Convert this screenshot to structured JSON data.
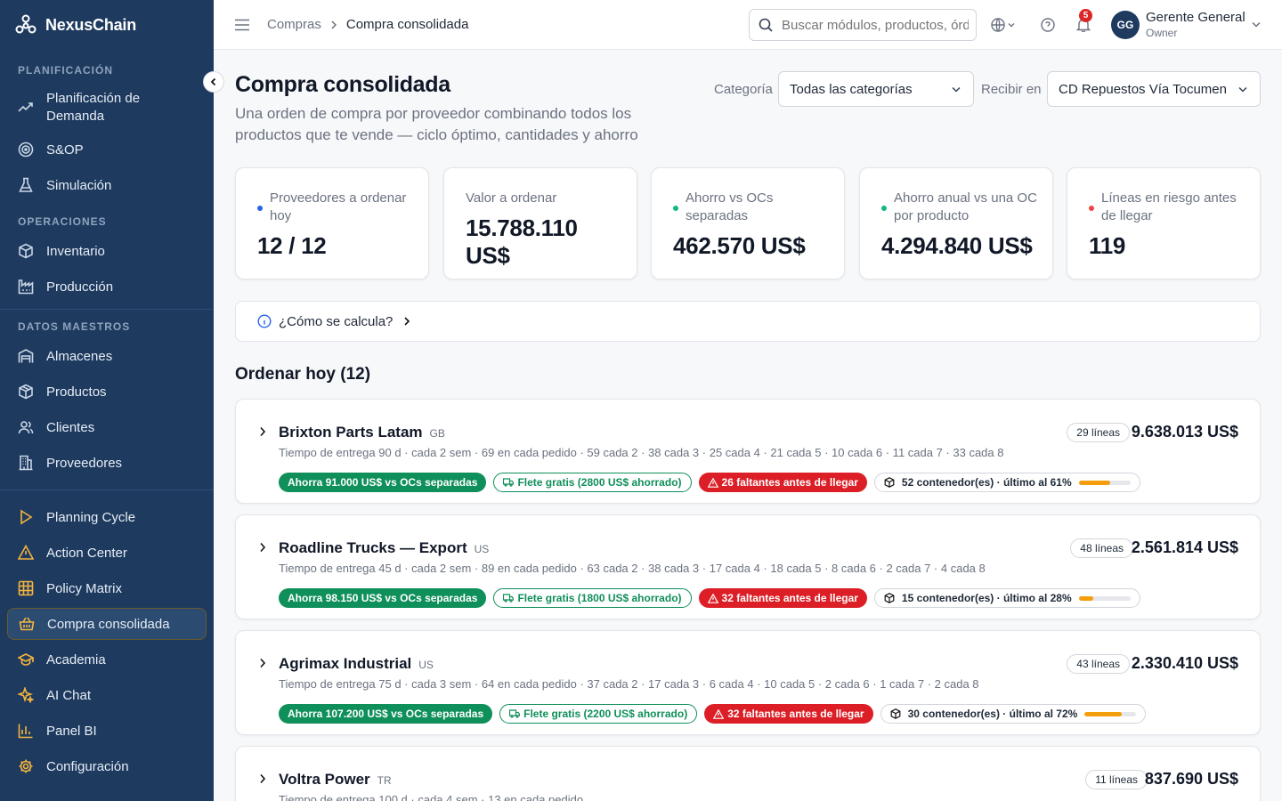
{
  "brand": {
    "name": "NexusChain"
  },
  "sidebar": {
    "sections": [
      {
        "title": "PLANIFICACIÓN",
        "items": [
          {
            "label": "Planificación de",
            "label2": "Demanda",
            "icon": "trend-icon"
          },
          {
            "label": "S&OP",
            "icon": "target-icon"
          },
          {
            "label": "Simulación",
            "icon": "flask-icon"
          }
        ]
      },
      {
        "title": "OPERACIONES",
        "items": [
          {
            "label": "Inventario",
            "icon": "box-icon"
          },
          {
            "label": "Producción",
            "icon": "factory-icon"
          }
        ]
      },
      {
        "title": "DATOS MAESTROS",
        "items": [
          {
            "label": "Almacenes",
            "icon": "warehouse-icon"
          },
          {
            "label": "Productos",
            "icon": "package-icon"
          },
          {
            "label": "Clientes",
            "icon": "users-icon"
          },
          {
            "label": "Proveedores",
            "icon": "building-icon"
          }
        ]
      }
    ],
    "bottom_items": [
      {
        "label": "Planning Cycle",
        "icon": "play-icon"
      },
      {
        "label": "Action Center",
        "icon": "warning-icon"
      },
      {
        "label": "Policy Matrix",
        "icon": "grid-icon"
      },
      {
        "label": "Compra consolidada",
        "icon": "basket-icon",
        "active": true
      },
      {
        "label": "Academia",
        "icon": "graduation-icon"
      },
      {
        "label": "AI Chat",
        "icon": "sparkle-icon"
      },
      {
        "label": "Panel BI",
        "icon": "bar-chart-icon"
      },
      {
        "label": "Configuración",
        "icon": "gear-icon"
      }
    ]
  },
  "topbar": {
    "breadcrumb": {
      "parent": "Compras",
      "separator": ">",
      "current": "Compra consolidada"
    },
    "search": {
      "placeholder": "Buscar módulos, productos, órdenes..."
    },
    "notifications": {
      "count": "5"
    },
    "user": {
      "initials": "GG",
      "name": "Gerente General",
      "role": "Owner"
    }
  },
  "header": {
    "title": "Compra consolidada",
    "subtitle": "Una orden de compra por proveedor combinando todos los productos que te vende — ciclo óptimo, cantidades y ahorro",
    "filters": {
      "category_label": "Categoría",
      "category_value": "Todas las categorías",
      "receive_label": "Recibir en",
      "receive_value": "CD Repuestos Vía Tocumen"
    }
  },
  "kpis": [
    {
      "label": "Proveedores a ordenar hoy",
      "value": "12 / 12",
      "dot": "#2563eb"
    },
    {
      "label": "Valor a ordenar",
      "value": "15.788.110 US$",
      "dot": ""
    },
    {
      "label": "Ahorro vs OCs separadas",
      "value": "462.570 US$",
      "dot": "#10b981"
    },
    {
      "label": "Ahorro anual vs una OC por producto",
      "value": "4.294.840 US$",
      "dot": "#10b981"
    },
    {
      "label": "Líneas en riesgo antes de llegar",
      "value": "119",
      "dot": "#ef4444"
    }
  ],
  "howto": {
    "label": "¿Cómo se calcula?"
  },
  "order_today": {
    "title": "Ordenar hoy (12)"
  },
  "suppliers": [
    {
      "name": "Brixton Parts Latam",
      "country": "GB",
      "meta": "Tiempo de entrega 90 d · cada 2 sem · 69 en cada pedido · 59 cada 2 · 38 cada 3 · 25 cada 4 · 21 cada 5 · 10 cada 6 · 11 cada 7 · 33 cada 8",
      "lines": "29 líneas",
      "total": "9.638.013 US$",
      "saving": "Ahorra 91.000 US$ vs OCs separadas",
      "freight": "Flete gratis (2800 US$ ahorrado)",
      "shortage": "26 faltantes antes de llegar",
      "containers": "52 contenedor(es) · último al 61%",
      "fill": 0.61
    },
    {
      "name": "Roadline Trucks — Export",
      "country": "US",
      "meta": "Tiempo de entrega 45 d · cada 2 sem · 89 en cada pedido · 63 cada 2 · 38 cada 3 · 17 cada 4 · 18 cada 5 · 8 cada 6 · 2 cada 7 · 4 cada 8",
      "lines": "48 líneas",
      "total": "2.561.814 US$",
      "saving": "Ahorra 98.150 US$ vs OCs separadas",
      "freight": "Flete gratis (1800 US$ ahorrado)",
      "shortage": "32 faltantes antes de llegar",
      "containers": "15 contenedor(es) · último al 28%",
      "fill": 0.28
    },
    {
      "name": "Agrimax Industrial",
      "country": "US",
      "meta": "Tiempo de entrega 75 d · cada 3 sem · 64 en cada pedido · 37 cada 2 · 17 cada 3 · 6 cada 4 · 10 cada 5 · 2 cada 6 · 1 cada 7 · 2 cada 8",
      "lines": "43 líneas",
      "total": "2.330.410 US$",
      "saving": "Ahorra 107.200 US$ vs OCs separadas",
      "freight": "Flete gratis (2200 US$ ahorrado)",
      "shortage": "32 faltantes antes de llegar",
      "containers": "30 contenedor(es) · último al 72%",
      "fill": 0.72
    },
    {
      "name": "Voltra Power",
      "country": "TR",
      "meta": "Tiempo de entrega 100 d · cada 4 sem · 13 en cada pedido",
      "lines": "11 líneas",
      "total": "837.690 US$"
    }
  ]
}
